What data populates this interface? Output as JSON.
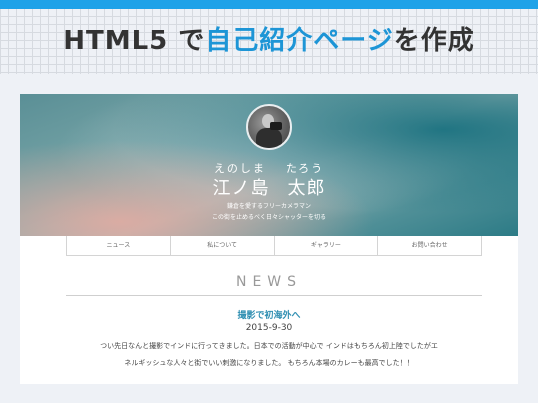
{
  "banner": {
    "title_prefix": "HTML5 で",
    "title_highlight": "自己紹介ページ",
    "title_suffix": "を作成",
    "accent_color": "#1ea2e8"
  },
  "site": {
    "avatar_icon": "photographer-portrait",
    "name_kana_family": "えのしま",
    "name_kana_given": "たろう",
    "name_family": "江ノ島",
    "name_given": "太郎",
    "tagline_1": "鎌倉を愛するフリーカメラマン",
    "tagline_2": "この街を止めるべく日々シャッターを切る",
    "nav": [
      {
        "label": "ニュース"
      },
      {
        "label": "私について"
      },
      {
        "label": "ギャラリー"
      },
      {
        "label": "お問い合わせ"
      }
    ],
    "section_title": "NEWS",
    "post": {
      "title": "撮影で初海外へ",
      "date": "2015-9-30",
      "body": "つい先日なんと撮影でインドに行ってきました。日本での活動が中心で インドはもちろん初上陸でしたがエネルギッシュな人々と街でいい刺激になりました。 もちろん本場のカレーも最高でした！！"
    }
  }
}
